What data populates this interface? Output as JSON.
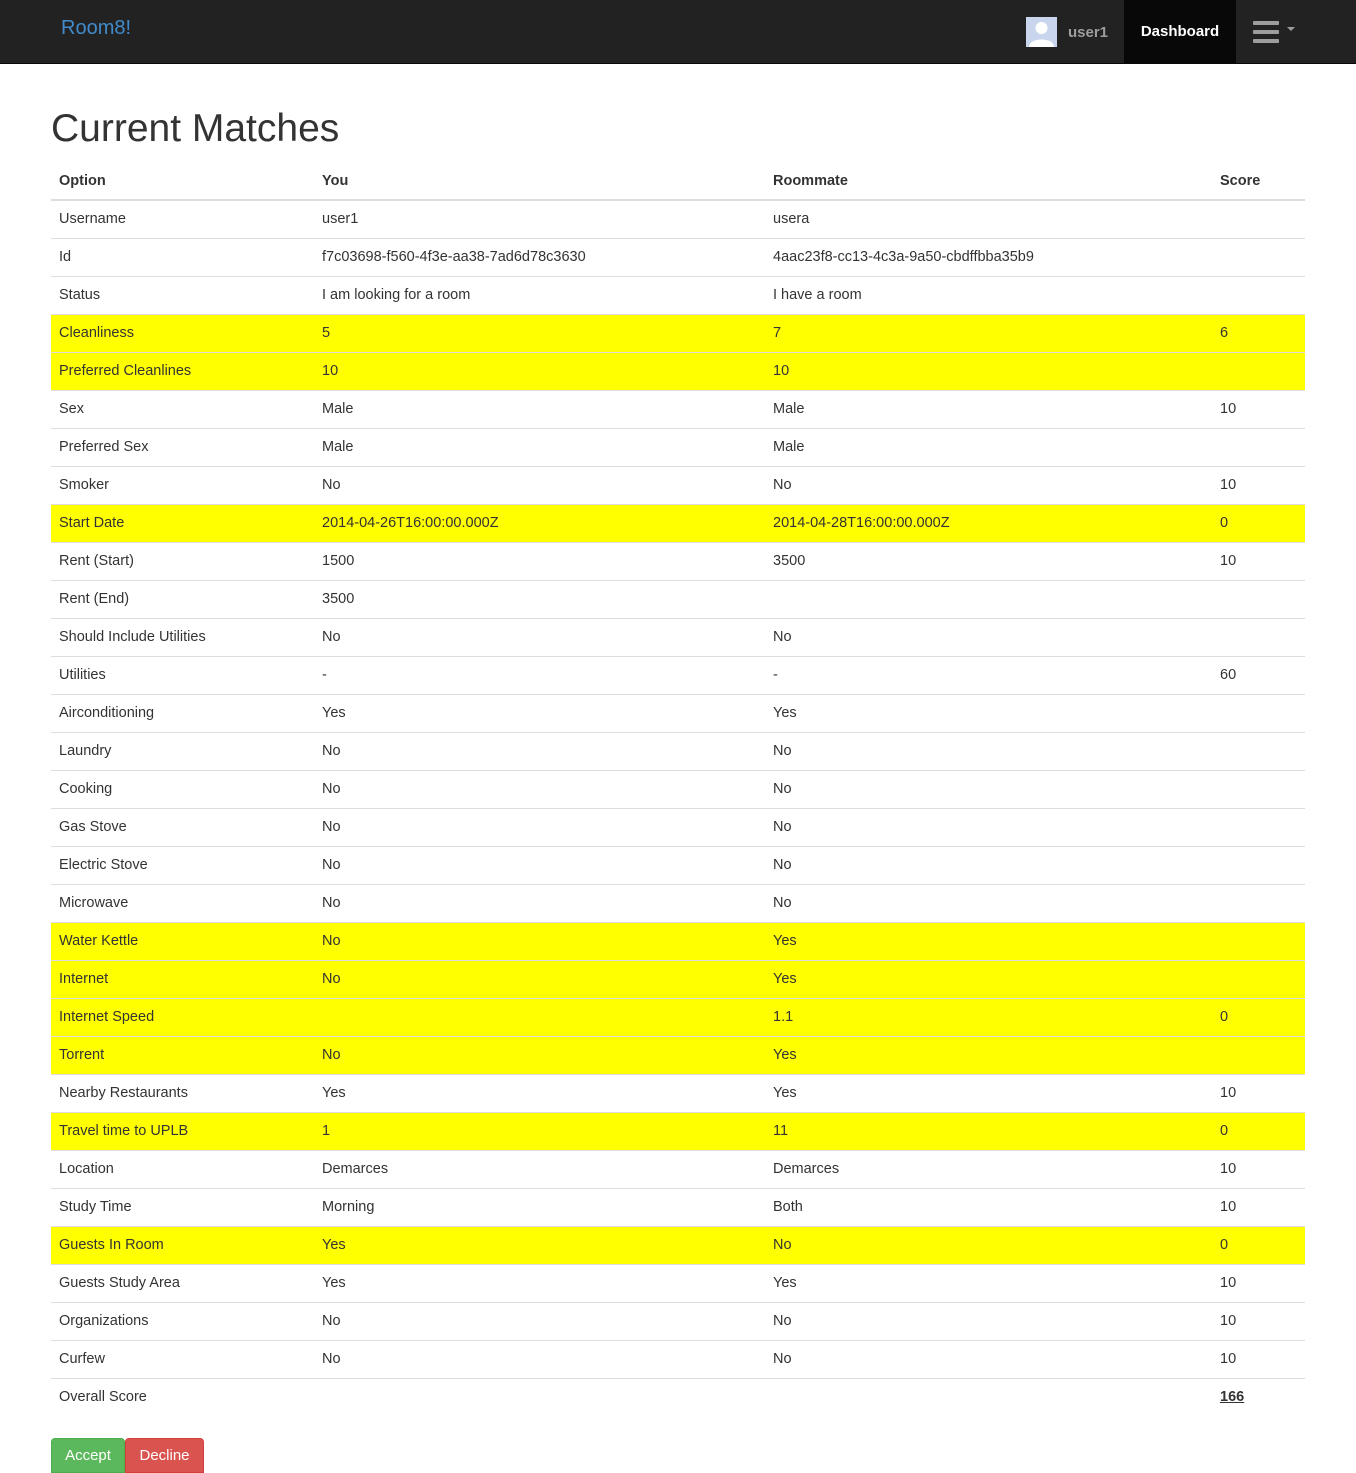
{
  "navbar": {
    "brand": "Room8!",
    "username": "user1",
    "dashboard_label": "Dashboard",
    "avatar_icon": "user-avatar-icon",
    "menu_icon": "hamburger-menu-icon",
    "dropdown_icon": "caret-down-icon"
  },
  "page": {
    "title": "Current Matches"
  },
  "colors": {
    "highlight": "#ffff00",
    "navbar": "#222222",
    "brand": "#428bca",
    "accept": "#5cb85c",
    "decline": "#d9534f"
  },
  "table": {
    "headers": [
      "Option",
      "You",
      "Roommate",
      "Score"
    ],
    "rows": [
      {
        "option": "Username",
        "you": "user1",
        "roommate": "usera",
        "score": "",
        "highlight": false
      },
      {
        "option": "Id",
        "you": "f7c03698-f560-4f3e-aa38-7ad6d78c3630",
        "roommate": "4aac23f8-cc13-4c3a-9a50-cbdffbba35b9",
        "score": "",
        "highlight": false
      },
      {
        "option": "Status",
        "you": "I am looking for a room",
        "roommate": "I have a room",
        "score": "",
        "highlight": false
      },
      {
        "option": "Cleanliness",
        "you": "5",
        "roommate": "7",
        "score": "6",
        "highlight": true
      },
      {
        "option": "Preferred Cleanlines",
        "you": "10",
        "roommate": "10",
        "score": "",
        "highlight": true
      },
      {
        "option": "Sex",
        "you": "Male",
        "roommate": "Male",
        "score": "10",
        "highlight": false
      },
      {
        "option": "Preferred Sex",
        "you": "Male",
        "roommate": "Male",
        "score": "",
        "highlight": false
      },
      {
        "option": "Smoker",
        "you": "No",
        "roommate": "No",
        "score": "10",
        "highlight": false
      },
      {
        "option": "Start Date",
        "you": "2014-04-26T16:00:00.000Z",
        "roommate": "2014-04-28T16:00:00.000Z",
        "score": "0",
        "highlight": true
      },
      {
        "option": "Rent (Start)",
        "you": "1500",
        "roommate": "3500",
        "score": "10",
        "highlight": false
      },
      {
        "option": "Rent (End)",
        "you": "3500",
        "roommate": "",
        "score": "",
        "highlight": false
      },
      {
        "option": "Should Include Utilities",
        "you": "No",
        "roommate": "No",
        "score": "",
        "highlight": false
      },
      {
        "option": "Utilities",
        "you": "-",
        "roommate": "-",
        "score": "60",
        "highlight": false
      },
      {
        "option": "Airconditioning",
        "you": "Yes",
        "roommate": "Yes",
        "score": "",
        "highlight": false
      },
      {
        "option": "Laundry",
        "you": "No",
        "roommate": "No",
        "score": "",
        "highlight": false
      },
      {
        "option": "Cooking",
        "you": "No",
        "roommate": "No",
        "score": "",
        "highlight": false
      },
      {
        "option": "Gas Stove",
        "you": "No",
        "roommate": "No",
        "score": "",
        "highlight": false
      },
      {
        "option": "Electric Stove",
        "you": "No",
        "roommate": "No",
        "score": "",
        "highlight": false
      },
      {
        "option": "Microwave",
        "you": "No",
        "roommate": "No",
        "score": "",
        "highlight": false
      },
      {
        "option": "Water Kettle",
        "you": "No",
        "roommate": "Yes",
        "score": "",
        "highlight": true
      },
      {
        "option": "Internet",
        "you": "No",
        "roommate": "Yes",
        "score": "",
        "highlight": true
      },
      {
        "option": "Internet Speed",
        "you": "",
        "roommate": "1.1",
        "score": "0",
        "highlight": true
      },
      {
        "option": "Torrent",
        "you": "No",
        "roommate": "Yes",
        "score": "",
        "highlight": true
      },
      {
        "option": "Nearby Restaurants",
        "you": "Yes",
        "roommate": "Yes",
        "score": "10",
        "highlight": false
      },
      {
        "option": "Travel time to UPLB",
        "you": "1",
        "roommate": "11",
        "score": "0",
        "highlight": true
      },
      {
        "option": "Location",
        "you": "Demarces",
        "roommate": "Demarces",
        "score": "10",
        "highlight": false
      },
      {
        "option": "Study Time",
        "you": "Morning",
        "roommate": "Both",
        "score": "10",
        "highlight": false
      },
      {
        "option": "Guests In Room",
        "you": "Yes",
        "roommate": "No",
        "score": "0",
        "highlight": true
      },
      {
        "option": "Guests Study Area",
        "you": "Yes",
        "roommate": "Yes",
        "score": "10",
        "highlight": false
      },
      {
        "option": "Organizations",
        "you": "No",
        "roommate": "No",
        "score": "10",
        "highlight": false
      },
      {
        "option": "Curfew",
        "you": "No",
        "roommate": "No",
        "score": "10",
        "highlight": false
      }
    ],
    "overall": {
      "label": "Overall Score",
      "score": "166"
    }
  },
  "actions": {
    "accept_label": "Accept",
    "decline_label": "Decline"
  }
}
